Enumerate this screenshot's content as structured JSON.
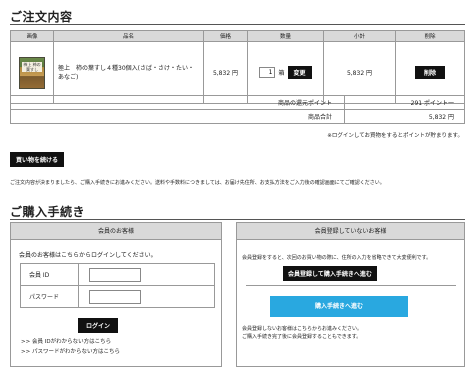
{
  "order": {
    "title": "ご注文内容",
    "headers": [
      "画像",
      "品名",
      "価格",
      "数量",
      "小計",
      "削除"
    ],
    "item": {
      "thumb_text": "柿上 柿の葉すし",
      "name": "極上　柿の葉すし４種30個入(さば・さけ・たい・あなご)",
      "price": "5,832 円",
      "quantity": "1",
      "unit": "箱",
      "change_label": "変更",
      "subtotal": "5,832 円",
      "delete_label": "削除"
    },
    "points_label": "商品の還元ポイント",
    "points_value": "291 ポイント一",
    "total_label": "商品合計",
    "total_value": "5,832 円",
    "login_note": "※ログインしてお買物をするとポイントが貯まります。",
    "continue_label": "買い物を続ける",
    "notice": "ご注文内容が決まりましたら、ご購入手続きにお進みください。送料や手数料につきましては、お届け先住所、お支払方法をご入力後の確認画面にてご確認ください。"
  },
  "checkout": {
    "title": "ご購入手続き",
    "member": {
      "header": "会員のお客様",
      "intro": "会員のお客様はこちらからログインしてください。",
      "id_label": "会員 ID",
      "password_label": "パスワード",
      "login_label": "ログイン",
      "forgot_id": ">> 会員 IDがわからない方はこちら",
      "forgot_password": ">> パスワードがわからない方はこちら"
    },
    "guest": {
      "header": "会員登録していないお客様",
      "text1": "会員登録をすると、次回のお買い物の際に、住所の入力を省略できて大変便利です。",
      "register_label": "会員登録して購入手続きへ進む",
      "proceed_label": "購入手続きへ進む",
      "text2a": "会員登録しないお客様はこちらからお進みください。",
      "text2b": "ご購入手続き完了後に会員登録することもできます。"
    }
  }
}
